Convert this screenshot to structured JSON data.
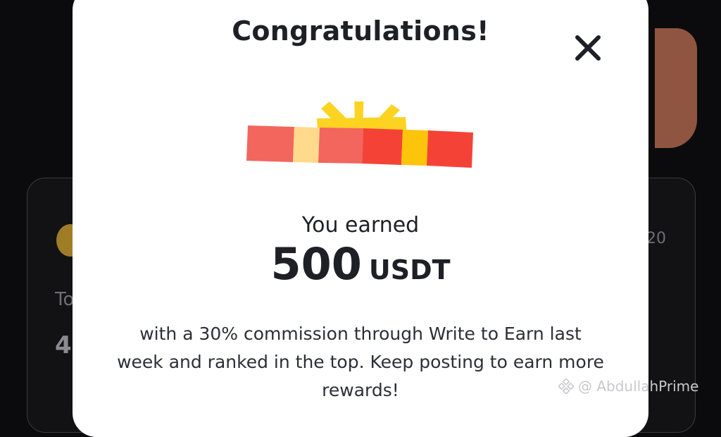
{
  "modal": {
    "title": "Congratulations!",
    "earned_label": "You earned",
    "amount": "500",
    "currency": "USDT",
    "message": "with a 30% commission through Write to Earn last week and ranked in the top. Keep posting to earn more rewards!"
  },
  "background": {
    "partial_text_left": "To",
    "partial_number_left": "4",
    "partial_number_right": "20"
  },
  "watermark": {
    "text": "@ AbdullahPrime"
  },
  "colors": {
    "gift_red": "#f44336",
    "gift_coral": "#f2665e",
    "gift_light": "#ffd98c",
    "gift_yellow": "#fcc40a",
    "gift_bow": "#fcd321"
  }
}
